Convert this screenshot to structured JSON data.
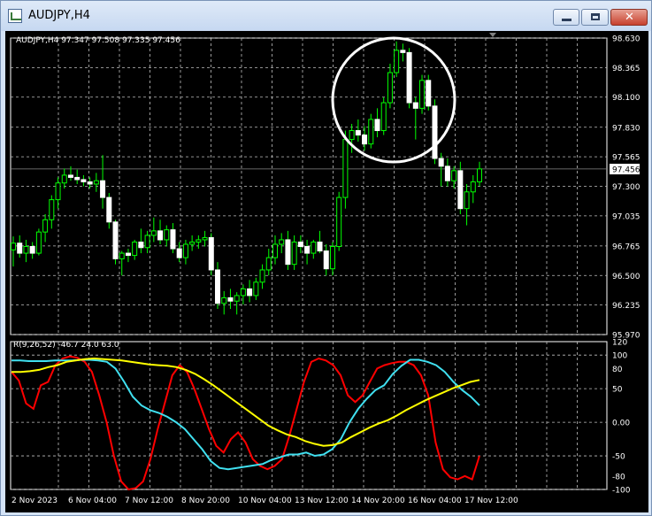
{
  "window": {
    "title": "AUDJPY,H4",
    "buttons": {
      "minimize": "minimize-icon",
      "maximize": "maximize-icon",
      "close": "close-icon"
    }
  },
  "header": {
    "symbol_info": "AUDJPY,H4  97.347 97.508 97.335 97.456",
    "indicator_info": "R(9,26,52) -46.7 24.0 63.0"
  },
  "price_label": "97.456",
  "colors": {
    "background": "#000000",
    "grid": "#c0c0c0",
    "bull": "#ffffff",
    "wick": "#00ff00",
    "axis_text": "#ffffff",
    "line_red": "#ff0000",
    "line_cyan": "#40e0f0",
    "line_yellow": "#ffff00",
    "annotation": "#ffffff"
  },
  "chart_data": [
    {
      "type": "candlestick",
      "symbol": "AUDJPY",
      "timeframe": "H4",
      "y_ticks": [
        "98.630",
        "98.365",
        "98.100",
        "97.830",
        "97.565",
        "97.300",
        "97.035",
        "96.765",
        "96.500",
        "96.235",
        "95.970"
      ],
      "ylim": [
        95.97,
        98.63
      ],
      "x_tick_labels": [
        "2 Nov 2023",
        "6 Nov 04:00",
        "7 Nov 12:00",
        "8 Nov 20:00",
        "10 Nov 04:00",
        "13 Nov 12:00",
        "14 Nov 20:00",
        "16 Nov 04:00",
        "17 Nov 12:00"
      ],
      "current_price": 97.456,
      "annotation": "circle around the 98.5–98.6 high",
      "candles": [
        [
          96.73,
          96.85,
          96.58,
          96.79
        ],
        [
          96.79,
          96.86,
          96.66,
          96.7
        ],
        [
          96.7,
          96.82,
          96.62,
          96.76
        ],
        [
          96.76,
          96.8,
          96.65,
          96.7
        ],
        [
          96.7,
          96.92,
          96.68,
          96.89
        ],
        [
          96.89,
          97.05,
          96.8,
          97.0
        ],
        [
          97.0,
          97.22,
          96.92,
          97.18
        ],
        [
          97.18,
          97.38,
          97.1,
          97.33
        ],
        [
          97.33,
          97.46,
          97.28,
          97.4
        ],
        [
          97.4,
          97.48,
          97.35,
          97.38
        ],
        [
          97.38,
          97.45,
          97.32,
          97.36
        ],
        [
          97.36,
          97.4,
          97.3,
          97.34
        ],
        [
          97.34,
          97.38,
          97.28,
          97.32
        ],
        [
          97.32,
          97.42,
          97.25,
          97.35
        ],
        [
          97.35,
          97.58,
          97.1,
          97.2
        ],
        [
          97.2,
          97.24,
          96.92,
          96.98
        ],
        [
          96.98,
          97.0,
          96.6,
          96.65
        ],
        [
          96.65,
          96.72,
          96.5,
          96.7
        ],
        [
          96.7,
          96.74,
          96.62,
          96.68
        ],
        [
          96.68,
          96.82,
          96.64,
          96.8
        ],
        [
          96.8,
          96.92,
          96.7,
          96.75
        ],
        [
          96.75,
          96.9,
          96.7,
          96.86
        ],
        [
          96.86,
          97.02,
          96.8,
          96.9
        ],
        [
          96.9,
          97.0,
          96.78,
          96.82
        ],
        [
          96.82,
          96.95,
          96.76,
          96.91
        ],
        [
          96.91,
          96.97,
          96.7,
          96.74
        ],
        [
          96.74,
          96.8,
          96.62,
          96.66
        ],
        [
          96.66,
          96.82,
          96.6,
          96.78
        ],
        [
          96.78,
          96.86,
          96.72,
          96.8
        ],
        [
          96.8,
          96.86,
          96.74,
          96.82
        ],
        [
          96.82,
          96.9,
          96.76,
          96.84
        ],
        [
          96.84,
          96.88,
          96.5,
          96.55
        ],
        [
          96.55,
          96.62,
          96.2,
          96.25
        ],
        [
          96.25,
          96.36,
          96.15,
          96.3
        ],
        [
          96.3,
          96.38,
          96.2,
          96.27
        ],
        [
          96.27,
          96.35,
          96.15,
          96.32
        ],
        [
          96.32,
          96.42,
          96.24,
          96.38
        ],
        [
          96.38,
          96.46,
          96.26,
          96.32
        ],
        [
          96.32,
          96.48,
          96.28,
          96.44
        ],
        [
          96.44,
          96.6,
          96.38,
          96.55
        ],
        [
          96.55,
          96.74,
          96.5,
          96.66
        ],
        [
          96.66,
          96.86,
          96.6,
          96.78
        ],
        [
          96.78,
          96.88,
          96.7,
          96.82
        ],
        [
          96.82,
          96.9,
          96.55,
          96.6
        ],
        [
          96.6,
          96.86,
          96.55,
          96.8
        ],
        [
          96.8,
          96.86,
          96.7,
          96.76
        ],
        [
          96.76,
          96.82,
          96.6,
          96.7
        ],
        [
          96.7,
          96.82,
          96.65,
          96.8
        ],
        [
          96.8,
          96.9,
          96.7,
          96.72
        ],
        [
          96.72,
          96.78,
          96.5,
          96.56
        ],
        [
          96.56,
          96.8,
          96.5,
          96.76
        ],
        [
          96.76,
          97.25,
          96.72,
          97.2
        ],
        [
          97.2,
          97.8,
          97.1,
          97.72
        ],
        [
          97.72,
          97.86,
          97.6,
          97.8
        ],
        [
          97.8,
          97.9,
          97.7,
          97.76
        ],
        [
          97.76,
          97.84,
          97.62,
          97.68
        ],
        [
          97.68,
          97.95,
          97.64,
          97.9
        ],
        [
          97.9,
          98.0,
          97.74,
          97.8
        ],
        [
          97.8,
          98.1,
          97.76,
          98.05
        ],
        [
          98.05,
          98.4,
          98.0,
          98.32
        ],
        [
          98.32,
          98.6,
          98.28,
          98.52
        ],
        [
          98.52,
          98.58,
          98.42,
          98.5
        ],
        [
          98.5,
          98.54,
          98.0,
          98.05
        ],
        [
          98.05,
          98.1,
          97.72,
          98.0
        ],
        [
          98.0,
          98.3,
          97.95,
          98.25
        ],
        [
          98.25,
          98.3,
          97.98,
          98.02
        ],
        [
          98.02,
          98.08,
          97.5,
          97.55
        ],
        [
          97.55,
          97.6,
          97.3,
          97.48
        ],
        [
          97.48,
          97.55,
          97.3,
          97.35
        ],
        [
          97.35,
          97.48,
          97.28,
          97.44
        ],
        [
          97.44,
          97.52,
          97.05,
          97.1
        ],
        [
          97.1,
          97.32,
          96.95,
          97.25
        ],
        [
          97.25,
          97.4,
          97.15,
          97.34
        ],
        [
          97.34,
          97.52,
          97.3,
          97.456
        ]
      ]
    },
    {
      "type": "line",
      "title": "R(9,26,52)",
      "values_shown": [
        -46.7,
        24.0,
        63.0
      ],
      "y_ticks": [
        "120",
        "100",
        "80",
        "50",
        "0.00",
        "-50",
        "-80",
        "-100"
      ],
      "ylim": [
        -100,
        120
      ],
      "series": [
        {
          "color": "red",
          "values": [
            75,
            62,
            28,
            20,
            55,
            60,
            85,
            95,
            98,
            96,
            90,
            75,
            40,
            0,
            -50,
            -88,
            -100,
            -98,
            -88,
            -55,
            -10,
            30,
            70,
            85,
            75,
            50,
            20,
            -10,
            -35,
            -45,
            -25,
            -15,
            -30,
            -55,
            -65,
            -70,
            -65,
            -55,
            -20,
            20,
            60,
            90,
            95,
            92,
            85,
            70,
            40,
            30,
            40,
            60,
            80,
            85,
            88,
            90,
            90,
            85,
            70,
            40,
            -30,
            -70,
            -82,
            -85,
            -80,
            -85,
            -50
          ]
        },
        {
          "color": "cyan",
          "values": [
            92,
            92,
            91,
            91,
            91,
            92,
            92,
            92,
            93,
            93,
            92,
            90,
            80,
            60,
            38,
            25,
            18,
            14,
            8,
            0,
            -10,
            -25,
            -40,
            -58,
            -68,
            -70,
            -68,
            -66,
            -64,
            -62,
            -56,
            -52,
            -48,
            -48,
            -45,
            -50,
            -48,
            -40,
            -25,
            0,
            20,
            35,
            48,
            55,
            72,
            84,
            93,
            93,
            90,
            85,
            75,
            60,
            48,
            38,
            25
          ]
        },
        {
          "color": "yellow",
          "values": [
            75,
            75,
            76,
            78,
            82,
            85,
            90,
            92,
            94,
            95,
            94,
            93,
            92,
            90,
            88,
            86,
            85,
            84,
            82,
            78,
            72,
            64,
            55,
            45,
            35,
            25,
            15,
            5,
            -5,
            -12,
            -18,
            -22,
            -28,
            -32,
            -35,
            -34,
            -30,
            -22,
            -15,
            -8,
            -2,
            3,
            10,
            18,
            25,
            32,
            38,
            44,
            50,
            55,
            60,
            63
          ]
        }
      ]
    }
  ]
}
